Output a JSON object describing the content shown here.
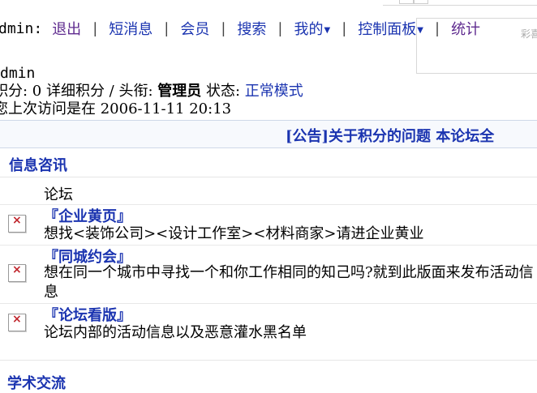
{
  "nav": {
    "user": "dmin:",
    "items": [
      {
        "label": "退出",
        "dropdown": false
      },
      {
        "label": "短消息",
        "dropdown": false
      },
      {
        "label": "会员",
        "dropdown": false
      },
      {
        "label": "搜索",
        "dropdown": false
      },
      {
        "label": "我的",
        "dropdown": true
      },
      {
        "label": "控制面板",
        "dropdown": true
      },
      {
        "label": "统计",
        "dropdown": false
      }
    ],
    "separator": "|",
    "caret": "▼"
  },
  "sidepanel": {
    "fragment": "彩喜"
  },
  "info": {
    "username": "dmin",
    "line2_prefix": "积分: 0 详细积分 / 头衔: ",
    "title_value": "管理员",
    "status_label": " 状态: ",
    "status_value": "正常模式",
    "line3": "您上次访问是在 2006-11-11 20:13"
  },
  "announcement": {
    "text": "[公告]关于积分的问题  本论坛全"
  },
  "category": {
    "title": "信息咨讯",
    "column_header": "论坛",
    "forums": [
      {
        "name": "『企业黄页』",
        "description": "想找<装饰公司><设计工作室><材料商家>请进企业黄业"
      },
      {
        "name": "『同城约会』",
        "description": "想在同一个城市中寻找一个和你工作相同的知己吗?就到此版面来发布活动信息"
      },
      {
        "name": "『论坛看版』",
        "description": "论坛内部的活动信息以及恶意灌水黑名单"
      }
    ]
  },
  "next_category": {
    "title": "学术交流"
  },
  "colors": {
    "link_purple": "#5f2b8f",
    "link_blue": "#1b34b0"
  }
}
